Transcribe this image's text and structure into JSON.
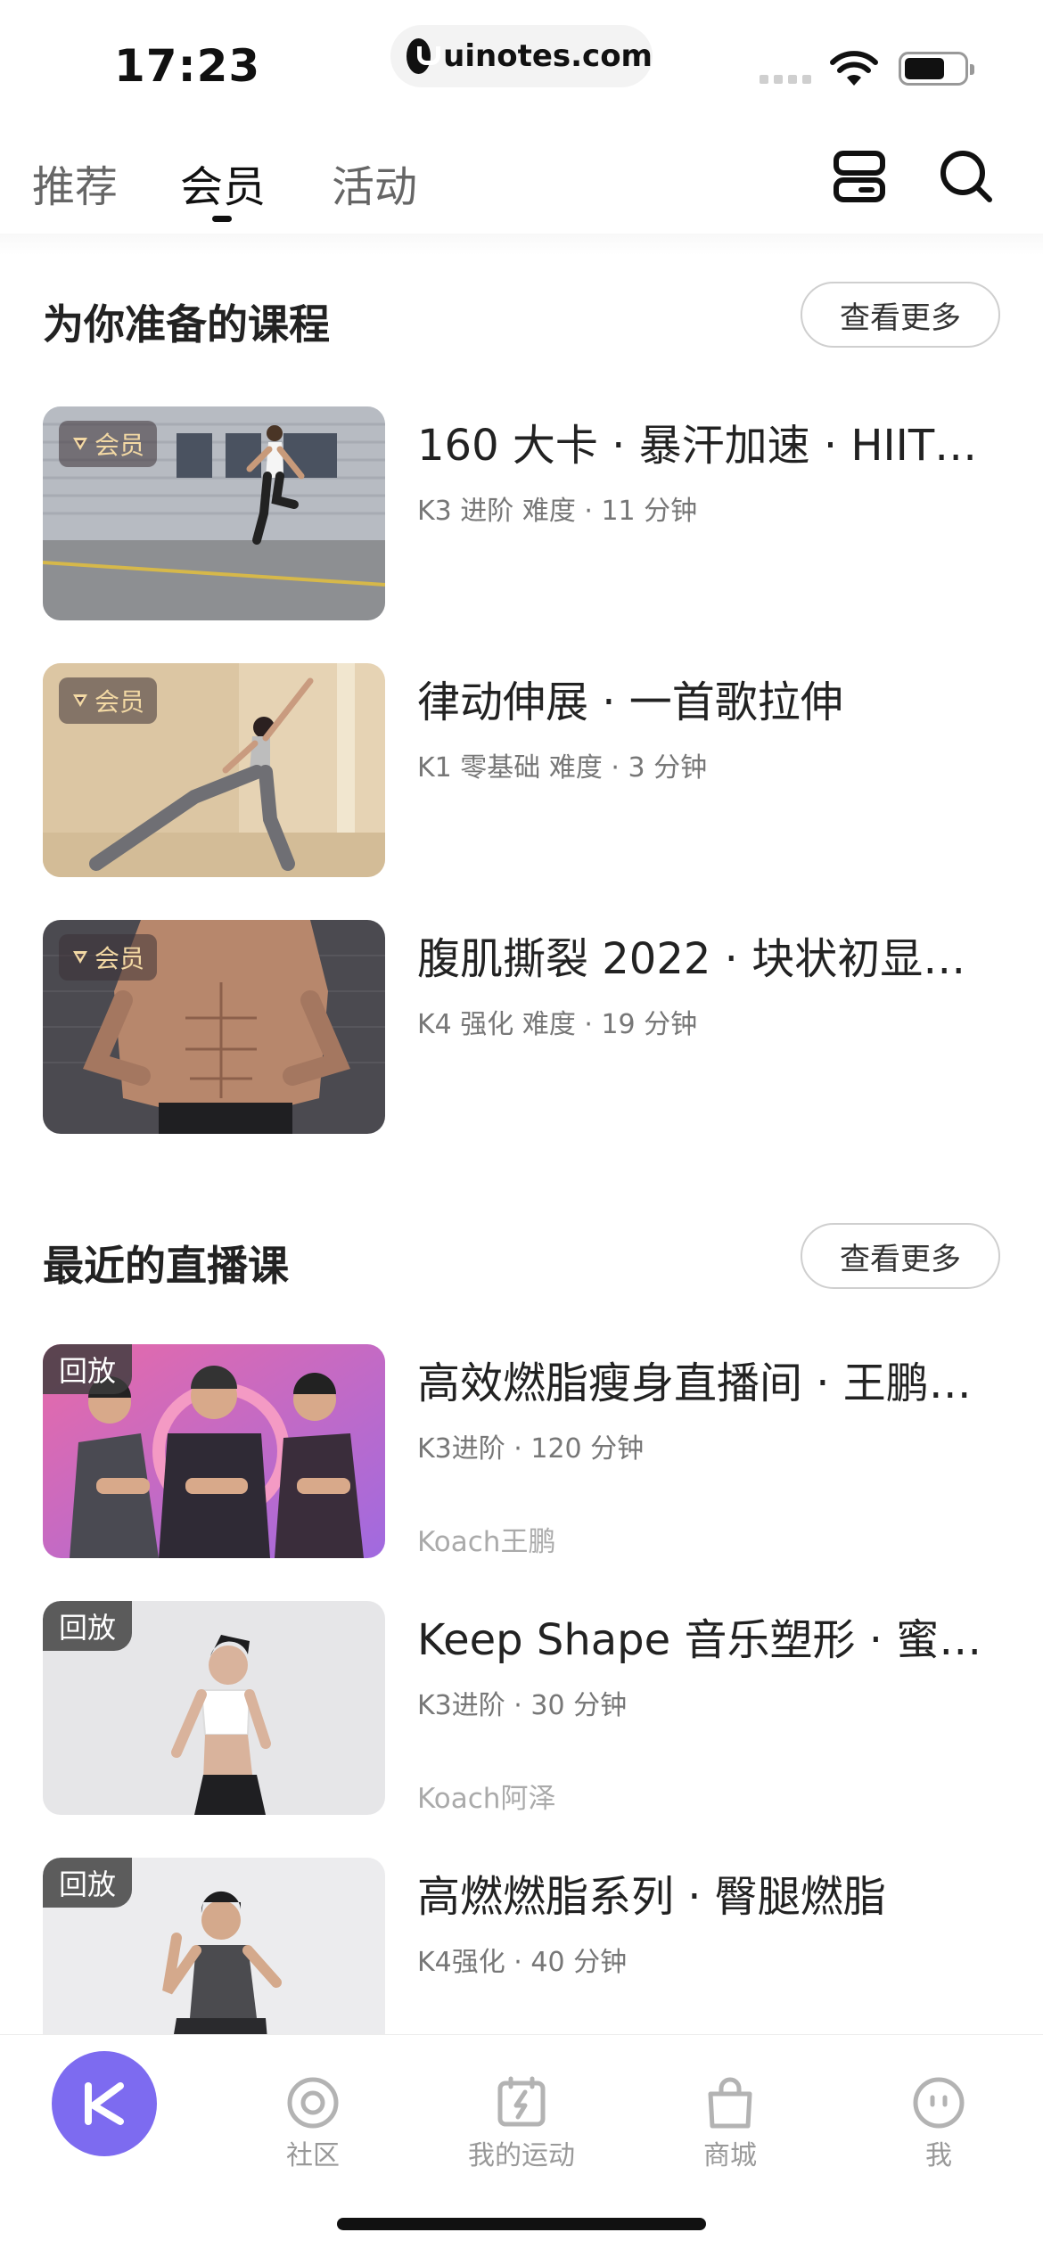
{
  "status_bar": {
    "time": "17:23",
    "url": "uinotes.com"
  },
  "top_tabs": {
    "items": [
      "推荐",
      "会员",
      "活动"
    ],
    "active_index": 1
  },
  "courses_section": {
    "title": "为你准备的课程",
    "more_label": "查看更多",
    "cards": [
      {
        "badge": "会员",
        "title": "160 大卡 · 暴汗加速 · HIIT…",
        "subtitle": "K3 进阶  难度 · 11  分钟"
      },
      {
        "badge": "会员",
        "title": "律动伸展 · 一首歌拉伸",
        "subtitle": "K1 零基础  难度 · 3   分钟"
      },
      {
        "badge": "会员",
        "title": "腹肌撕裂 2022 · 块状初显…",
        "subtitle": "K4 强化  难度 · 19  分钟"
      }
    ]
  },
  "live_section": {
    "title": "最近的直播课",
    "more_label": "查看更多",
    "cards": [
      {
        "badge": "回放",
        "title": "高效燃脂瘦身直播间 · 王鹏…",
        "subtitle": "K3进阶 · 120 分钟",
        "coach": "Koach王鹏"
      },
      {
        "badge": "回放",
        "title": "Keep Shape 音乐塑形 · 蜜…",
        "subtitle": "K3进阶 · 30 分钟",
        "coach": "Koach阿泽"
      },
      {
        "badge": "回放",
        "title": "高燃燃脂系列 · 臀腿燃脂",
        "subtitle": "K4强化 · 40 分钟",
        "coach": ""
      }
    ]
  },
  "bottom_nav": {
    "items": [
      {
        "label": "",
        "icon": "keep-logo-icon"
      },
      {
        "label": "社区",
        "icon": "community-icon"
      },
      {
        "label": "我的运动",
        "icon": "my-sports-icon"
      },
      {
        "label": "商城",
        "icon": "shop-bag-icon"
      },
      {
        "label": "我",
        "icon": "profile-face-icon"
      }
    ]
  },
  "colors": {
    "brand_purple": "#7d6bf0",
    "member_badge_text": "#f3d9a4"
  }
}
